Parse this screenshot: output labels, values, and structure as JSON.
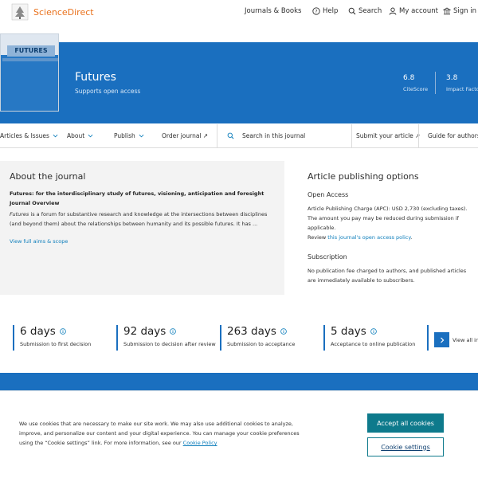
{
  "header": {
    "brand": "ScienceDirect",
    "nav": [
      {
        "label": "Journals & Books",
        "icon": ""
      },
      {
        "label": "Help",
        "icon": "help-icon"
      },
      {
        "label": "Search",
        "icon": "search-icon"
      },
      {
        "label": "My account",
        "icon": "user-icon"
      },
      {
        "label": "Sign in",
        "icon": "institution-icon"
      }
    ]
  },
  "journal": {
    "cover_title": "FUTURES",
    "title": "Futures",
    "subtitle": "Supports open access",
    "metrics": [
      {
        "value": "6.8",
        "label": "CiteScore"
      },
      {
        "value": "3.8",
        "label": "Impact Factor"
      }
    ]
  },
  "subnav": {
    "items": [
      "Articles & Issues",
      "About",
      "Publish",
      "Order journal ↗"
    ],
    "search_placeholder": "Search in this journal",
    "submit": "Submit your article ↗",
    "guide": "Guide for authors"
  },
  "about": {
    "heading": "About the journal",
    "bold_line": "Futures: for the interdisciplinary study of futures, visioning, anticipation and foresight",
    "overview_label": "Journal Overview",
    "text_em": "Futures",
    "text_rest": " is a forum for substantive research and knowledge at the intersections between disciplines (and beyond them) about the relationships between humanity and its possible futures. It has ...",
    "link": "View full aims & scope"
  },
  "publishing": {
    "heading": "Article publishing options",
    "open_access": {
      "title": "Open Access",
      "text": "Article Publishing Charge (APC): USD 2,730 (excluding taxes). The amount you pay may be reduced during submission if applicable.",
      "review_prefix": "Review ",
      "review_link": "this journal's open access policy",
      "review_suffix": "."
    },
    "subscription": {
      "title": "Subscription",
      "text": "No publication fee charged to authors, and published articles are immediately available to subscribers."
    }
  },
  "stats": [
    {
      "value": "6 days",
      "label": "Submission to first decision"
    },
    {
      "value": "92 days",
      "label": "Submission to decision after review"
    },
    {
      "value": "263 days",
      "label": "Submission to acceptance"
    },
    {
      "value": "5 days",
      "label": "Acceptance to online publication"
    }
  ],
  "view_all": "View all in",
  "cookie": {
    "text": "We use cookies that are necessary to make our site work. We may also use additional cookies to analyze, improve, and personalize our content and your digital experience. You can manage your cookie preferences using the “Cookie settings” link. For more information, see our ",
    "link": "Cookie Policy",
    "accept": "Accept all cookies",
    "settings": "Cookie settings"
  },
  "colors": {
    "brand_orange": "#e9711c",
    "banner_blue": "#1a6fbf",
    "link_blue": "#0c7dbb",
    "cookie_teal": "#0e7a8c"
  }
}
